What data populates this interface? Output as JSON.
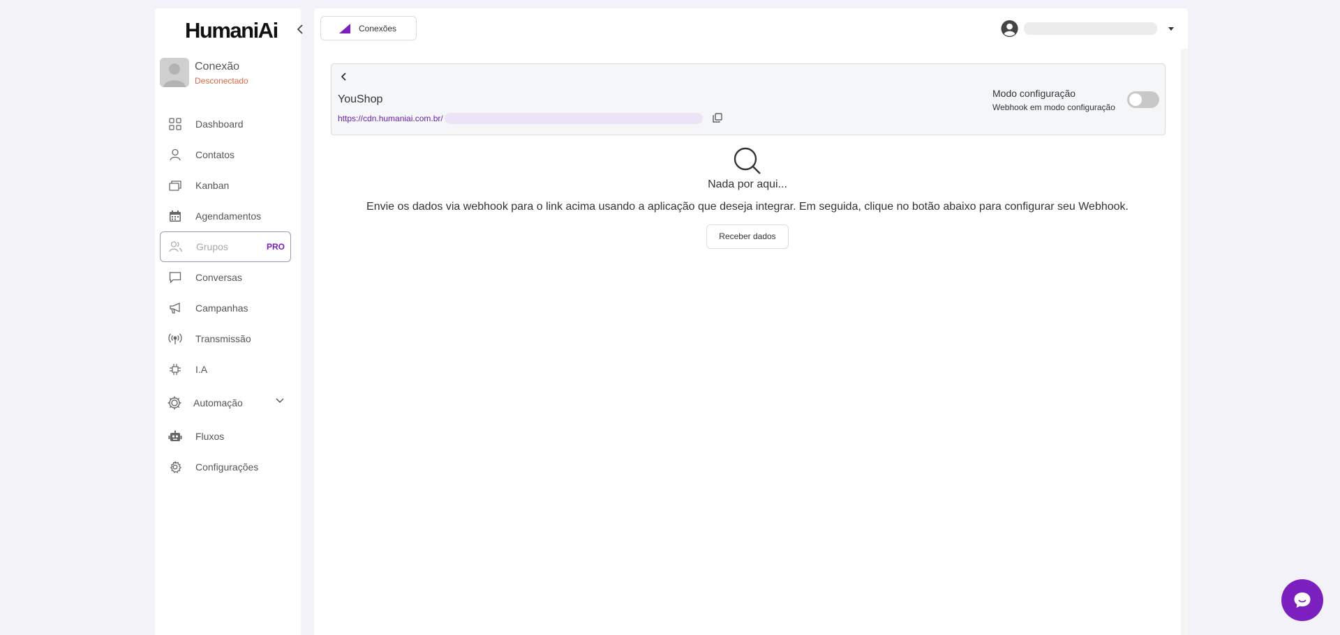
{
  "app": {
    "logo": "HumaniAi"
  },
  "connection": {
    "title": "Conexão",
    "status": "Desconectado",
    "status_color": "#e0664a"
  },
  "sidebar": {
    "items": [
      {
        "label": "Dashboard",
        "icon": "grid-icon"
      },
      {
        "label": "Contatos",
        "icon": "user-icon"
      },
      {
        "label": "Kanban",
        "icon": "cards-icon"
      },
      {
        "label": "Agendamentos",
        "icon": "calendar-icon"
      },
      {
        "label": "Grupos",
        "icon": "users-icon",
        "badge": "PRO"
      },
      {
        "label": "Conversas",
        "icon": "chat-bubble-icon"
      },
      {
        "label": "Campanhas",
        "icon": "megaphone-icon"
      },
      {
        "label": "Transmissão",
        "icon": "broadcast-icon"
      },
      {
        "label": "I.A",
        "icon": "chip-icon"
      },
      {
        "label": "Automação",
        "icon": "cog-icon"
      },
      {
        "label": "Fluxos",
        "icon": "robot-icon"
      },
      {
        "label": "Configurações",
        "icon": "settings-icon"
      }
    ]
  },
  "header": {
    "tab_label": "Conexões",
    "accent": "#7b1fbf"
  },
  "integration": {
    "title": "YouShop",
    "webhook_url": "https://cdn.humaniai.com.br/",
    "mode_title": "Modo configuração",
    "mode_subtitle": "Webhook em modo configuração",
    "mode_enabled": false
  },
  "empty_state": {
    "title": "Nada por aqui...",
    "description": "Envie os dados via webhook para o link acima usando a aplicação que deseja integrar. Em seguida, clique no botão abaixo para configurar seu Webhook.",
    "button": "Receber dados"
  }
}
